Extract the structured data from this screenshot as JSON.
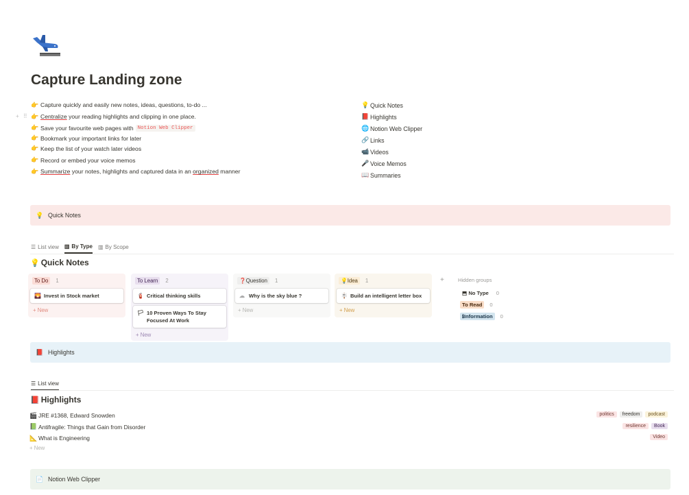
{
  "page": {
    "title": "Capture Landing zone",
    "cover_icon": "airplane-arriving-icon"
  },
  "intro_bullets": [
    {
      "icon": "pointing-hand-icon",
      "text": "Capture quickly and easily new notes, ideas, questions, to-do ..."
    },
    {
      "icon": "pointing-hand-icon",
      "pre": "",
      "underlined": "Centralize",
      "text": " your reading highlights and clipping in one place."
    },
    {
      "icon": "pointing-hand-icon",
      "text": "Save your favourite web pages with",
      "code": "Notion Web Clipper"
    },
    {
      "icon": "pointing-hand-icon",
      "text": "Bookmark your important links for later"
    },
    {
      "icon": "pointing-hand-icon",
      "text": "Keep the list of your watch later videos"
    },
    {
      "icon": "pointing-hand-icon",
      "text": "Record or embed your voice memos"
    },
    {
      "icon": "pointing-hand-icon",
      "underlined": "Summarize",
      "text": " your notes, highlights and captured data in an ",
      "underlined2": "organized",
      "text2": " manner"
    }
  ],
  "toc": [
    {
      "icon": "💡",
      "label": "Quick Notes"
    },
    {
      "icon": "📕",
      "label": "Highlights"
    },
    {
      "icon": "🌐",
      "label": "Notion Web Clipper"
    },
    {
      "icon": "🔗",
      "label": "Links"
    },
    {
      "icon": "📹",
      "label": "Videos"
    },
    {
      "icon": "🎤",
      "label": "Voice Memos"
    },
    {
      "icon": "📖",
      "label": "Summaries"
    }
  ],
  "callouts": {
    "quick_notes": {
      "icon": "💡",
      "label": "Quick Notes"
    },
    "highlights": {
      "icon": "📕",
      "label": "Highlights"
    },
    "web_clipper": {
      "icon": "📄",
      "label": "Notion Web Clipper"
    }
  },
  "quick_notes_db": {
    "tabs": [
      {
        "icon": "☰",
        "label": "List view",
        "active": false
      },
      {
        "icon": "▥",
        "label": "By Type",
        "active": true
      },
      {
        "icon": "▥",
        "label": "By Scope",
        "active": false
      }
    ],
    "title": "Quick Notes",
    "title_icon": "💡",
    "columns": [
      {
        "label": "To Do",
        "count": "1",
        "pill_bg": "#fbdcd6",
        "pill_fg": "#5d1715",
        "col_bg": "#fcf2f1",
        "new_color": "#e08a7e",
        "cards": [
          {
            "icon": "🌄",
            "title": "Invest in Stock market"
          }
        ],
        "new_label": "+ New"
      },
      {
        "label": "To Learn",
        "count": "2",
        "pill_bg": "#e8deee",
        "pill_fg": "#412454",
        "col_bg": "#f6f3f9",
        "new_color": "#9b86b1",
        "cards": [
          {
            "icon": "🧯",
            "title": "Critical thinking skills"
          },
          {
            "icon": "🏳",
            "title": "10 Proven Ways To Stay Focused At Work"
          }
        ],
        "new_label": "+ New"
      },
      {
        "label": "Question",
        "count": "1",
        "pill_bg": "#eeeeed",
        "pill_fg": "#37352f",
        "pill_icon": "❓",
        "col_bg": "#f8f8f7",
        "new_color": "#b4b4b0",
        "cards": [
          {
            "icon": "☁",
            "title": "Why is the sky blue ?"
          }
        ],
        "new_label": "+ New"
      },
      {
        "label": "Idea",
        "count": "1",
        "pill_bg": "#fbedd6",
        "pill_fg": "#4f3a13",
        "pill_icon": "💡",
        "col_bg": "#faf6ee",
        "new_color": "#d19d4a",
        "cards": [
          {
            "icon": "🪧",
            "title": "Build an intelligent letter box"
          }
        ],
        "new_label": "+ New"
      }
    ],
    "add_group": "+",
    "hidden_groups": {
      "label": "Hidden groups",
      "items": [
        {
          "label": "No Type",
          "count": "0",
          "icon": "⬒",
          "pill_bg": "transparent",
          "pill_fg": "#37352f"
        },
        {
          "label": "To Read",
          "count": "0",
          "pill_bg": "#fadec9",
          "pill_fg": "#49290e"
        },
        {
          "label": "Information",
          "count": "0",
          "icon": "ℹ",
          "pill_bg": "#d3e5ef",
          "pill_fg": "#183347"
        }
      ]
    }
  },
  "highlights_db": {
    "tab": {
      "icon": "☰",
      "label": "List view"
    },
    "title": "Highlights",
    "title_icon": "📕",
    "rows": [
      {
        "icon": "🎬",
        "title": "JRE #1368, Edward Snowden",
        "tags": [
          {
            "label": "politics",
            "bg": "#fbe4e4",
            "fg": "#6e3630"
          },
          {
            "label": "freedom",
            "bg": "#eeeeed",
            "fg": "#37352f"
          },
          {
            "label": "podcast",
            "bg": "#fbf3db",
            "fg": "#6d531e"
          }
        ]
      },
      {
        "icon": "📗",
        "title": "Antifragile: Things that Gain from Disorder",
        "tags": [
          {
            "label": "resilience",
            "bg": "#fbe4e4",
            "fg": "#6e3630"
          },
          {
            "label": "Book",
            "bg": "#e8deee",
            "fg": "#412454"
          }
        ]
      },
      {
        "icon": "📐",
        "title": "What is Engineering",
        "tags": [
          {
            "label": "Video",
            "bg": "#fbe4e4",
            "fg": "#6e3630"
          }
        ]
      }
    ],
    "new_label": "+ New"
  }
}
